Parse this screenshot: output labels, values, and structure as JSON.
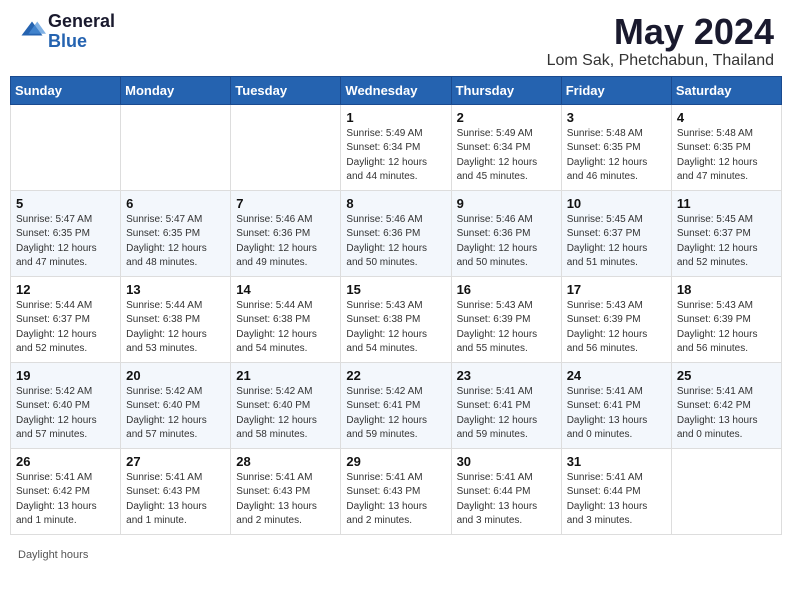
{
  "header": {
    "logo_general": "General",
    "logo_blue": "Blue",
    "month_year": "May 2024",
    "location": "Lom Sak, Phetchabun, Thailand"
  },
  "footer": {
    "daylight_label": "Daylight hours"
  },
  "calendar": {
    "days_of_week": [
      "Sunday",
      "Monday",
      "Tuesday",
      "Wednesday",
      "Thursday",
      "Friday",
      "Saturday"
    ],
    "weeks": [
      [
        {
          "day": "",
          "info": ""
        },
        {
          "day": "",
          "info": ""
        },
        {
          "day": "",
          "info": ""
        },
        {
          "day": "1",
          "info": "Sunrise: 5:49 AM\nSunset: 6:34 PM\nDaylight: 12 hours\nand 44 minutes."
        },
        {
          "day": "2",
          "info": "Sunrise: 5:49 AM\nSunset: 6:34 PM\nDaylight: 12 hours\nand 45 minutes."
        },
        {
          "day": "3",
          "info": "Sunrise: 5:48 AM\nSunset: 6:35 PM\nDaylight: 12 hours\nand 46 minutes."
        },
        {
          "day": "4",
          "info": "Sunrise: 5:48 AM\nSunset: 6:35 PM\nDaylight: 12 hours\nand 47 minutes."
        }
      ],
      [
        {
          "day": "5",
          "info": "Sunrise: 5:47 AM\nSunset: 6:35 PM\nDaylight: 12 hours\nand 47 minutes."
        },
        {
          "day": "6",
          "info": "Sunrise: 5:47 AM\nSunset: 6:35 PM\nDaylight: 12 hours\nand 48 minutes."
        },
        {
          "day": "7",
          "info": "Sunrise: 5:46 AM\nSunset: 6:36 PM\nDaylight: 12 hours\nand 49 minutes."
        },
        {
          "day": "8",
          "info": "Sunrise: 5:46 AM\nSunset: 6:36 PM\nDaylight: 12 hours\nand 50 minutes."
        },
        {
          "day": "9",
          "info": "Sunrise: 5:46 AM\nSunset: 6:36 PM\nDaylight: 12 hours\nand 50 minutes."
        },
        {
          "day": "10",
          "info": "Sunrise: 5:45 AM\nSunset: 6:37 PM\nDaylight: 12 hours\nand 51 minutes."
        },
        {
          "day": "11",
          "info": "Sunrise: 5:45 AM\nSunset: 6:37 PM\nDaylight: 12 hours\nand 52 minutes."
        }
      ],
      [
        {
          "day": "12",
          "info": "Sunrise: 5:44 AM\nSunset: 6:37 PM\nDaylight: 12 hours\nand 52 minutes."
        },
        {
          "day": "13",
          "info": "Sunrise: 5:44 AM\nSunset: 6:38 PM\nDaylight: 12 hours\nand 53 minutes."
        },
        {
          "day": "14",
          "info": "Sunrise: 5:44 AM\nSunset: 6:38 PM\nDaylight: 12 hours\nand 54 minutes."
        },
        {
          "day": "15",
          "info": "Sunrise: 5:43 AM\nSunset: 6:38 PM\nDaylight: 12 hours\nand 54 minutes."
        },
        {
          "day": "16",
          "info": "Sunrise: 5:43 AM\nSunset: 6:39 PM\nDaylight: 12 hours\nand 55 minutes."
        },
        {
          "day": "17",
          "info": "Sunrise: 5:43 AM\nSunset: 6:39 PM\nDaylight: 12 hours\nand 56 minutes."
        },
        {
          "day": "18",
          "info": "Sunrise: 5:43 AM\nSunset: 6:39 PM\nDaylight: 12 hours\nand 56 minutes."
        }
      ],
      [
        {
          "day": "19",
          "info": "Sunrise: 5:42 AM\nSunset: 6:40 PM\nDaylight: 12 hours\nand 57 minutes."
        },
        {
          "day": "20",
          "info": "Sunrise: 5:42 AM\nSunset: 6:40 PM\nDaylight: 12 hours\nand 57 minutes."
        },
        {
          "day": "21",
          "info": "Sunrise: 5:42 AM\nSunset: 6:40 PM\nDaylight: 12 hours\nand 58 minutes."
        },
        {
          "day": "22",
          "info": "Sunrise: 5:42 AM\nSunset: 6:41 PM\nDaylight: 12 hours\nand 59 minutes."
        },
        {
          "day": "23",
          "info": "Sunrise: 5:41 AM\nSunset: 6:41 PM\nDaylight: 12 hours\nand 59 minutes."
        },
        {
          "day": "24",
          "info": "Sunrise: 5:41 AM\nSunset: 6:41 PM\nDaylight: 13 hours\nand 0 minutes."
        },
        {
          "day": "25",
          "info": "Sunrise: 5:41 AM\nSunset: 6:42 PM\nDaylight: 13 hours\nand 0 minutes."
        }
      ],
      [
        {
          "day": "26",
          "info": "Sunrise: 5:41 AM\nSunset: 6:42 PM\nDaylight: 13 hours\nand 1 minute."
        },
        {
          "day": "27",
          "info": "Sunrise: 5:41 AM\nSunset: 6:43 PM\nDaylight: 13 hours\nand 1 minute."
        },
        {
          "day": "28",
          "info": "Sunrise: 5:41 AM\nSunset: 6:43 PM\nDaylight: 13 hours\nand 2 minutes."
        },
        {
          "day": "29",
          "info": "Sunrise: 5:41 AM\nSunset: 6:43 PM\nDaylight: 13 hours\nand 2 minutes."
        },
        {
          "day": "30",
          "info": "Sunrise: 5:41 AM\nSunset: 6:44 PM\nDaylight: 13 hours\nand 3 minutes."
        },
        {
          "day": "31",
          "info": "Sunrise: 5:41 AM\nSunset: 6:44 PM\nDaylight: 13 hours\nand 3 minutes."
        },
        {
          "day": "",
          "info": ""
        }
      ]
    ]
  }
}
